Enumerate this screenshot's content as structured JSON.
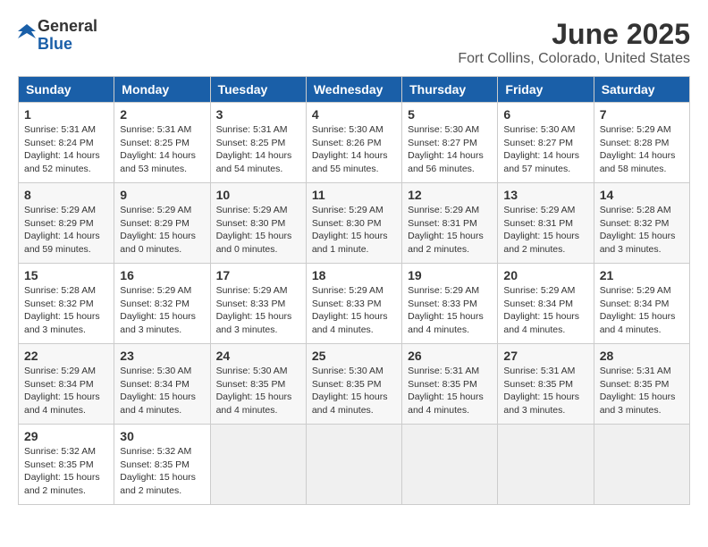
{
  "header": {
    "logo_general": "General",
    "logo_blue": "Blue",
    "month": "June 2025",
    "location": "Fort Collins, Colorado, United States"
  },
  "days_of_week": [
    "Sunday",
    "Monday",
    "Tuesday",
    "Wednesday",
    "Thursday",
    "Friday",
    "Saturday"
  ],
  "weeks": [
    [
      {
        "day": "1",
        "sunrise": "5:31 AM",
        "sunset": "8:24 PM",
        "daylight": "14 hours and 52 minutes."
      },
      {
        "day": "2",
        "sunrise": "5:31 AM",
        "sunset": "8:25 PM",
        "daylight": "14 hours and 53 minutes."
      },
      {
        "day": "3",
        "sunrise": "5:31 AM",
        "sunset": "8:25 PM",
        "daylight": "14 hours and 54 minutes."
      },
      {
        "day": "4",
        "sunrise": "5:30 AM",
        "sunset": "8:26 PM",
        "daylight": "14 hours and 55 minutes."
      },
      {
        "day": "5",
        "sunrise": "5:30 AM",
        "sunset": "8:27 PM",
        "daylight": "14 hours and 56 minutes."
      },
      {
        "day": "6",
        "sunrise": "5:30 AM",
        "sunset": "8:27 PM",
        "daylight": "14 hours and 57 minutes."
      },
      {
        "day": "7",
        "sunrise": "5:29 AM",
        "sunset": "8:28 PM",
        "daylight": "14 hours and 58 minutes."
      }
    ],
    [
      {
        "day": "8",
        "sunrise": "5:29 AM",
        "sunset": "8:29 PM",
        "daylight": "14 hours and 59 minutes."
      },
      {
        "day": "9",
        "sunrise": "5:29 AM",
        "sunset": "8:29 PM",
        "daylight": "15 hours and 0 minutes."
      },
      {
        "day": "10",
        "sunrise": "5:29 AM",
        "sunset": "8:30 PM",
        "daylight": "15 hours and 0 minutes."
      },
      {
        "day": "11",
        "sunrise": "5:29 AM",
        "sunset": "8:30 PM",
        "daylight": "15 hours and 1 minute."
      },
      {
        "day": "12",
        "sunrise": "5:29 AM",
        "sunset": "8:31 PM",
        "daylight": "15 hours and 2 minutes."
      },
      {
        "day": "13",
        "sunrise": "5:29 AM",
        "sunset": "8:31 PM",
        "daylight": "15 hours and 2 minutes."
      },
      {
        "day": "14",
        "sunrise": "5:28 AM",
        "sunset": "8:32 PM",
        "daylight": "15 hours and 3 minutes."
      }
    ],
    [
      {
        "day": "15",
        "sunrise": "5:28 AM",
        "sunset": "8:32 PM",
        "daylight": "15 hours and 3 minutes."
      },
      {
        "day": "16",
        "sunrise": "5:29 AM",
        "sunset": "8:32 PM",
        "daylight": "15 hours and 3 minutes."
      },
      {
        "day": "17",
        "sunrise": "5:29 AM",
        "sunset": "8:33 PM",
        "daylight": "15 hours and 3 minutes."
      },
      {
        "day": "18",
        "sunrise": "5:29 AM",
        "sunset": "8:33 PM",
        "daylight": "15 hours and 4 minutes."
      },
      {
        "day": "19",
        "sunrise": "5:29 AM",
        "sunset": "8:33 PM",
        "daylight": "15 hours and 4 minutes."
      },
      {
        "day": "20",
        "sunrise": "5:29 AM",
        "sunset": "8:34 PM",
        "daylight": "15 hours and 4 minutes."
      },
      {
        "day": "21",
        "sunrise": "5:29 AM",
        "sunset": "8:34 PM",
        "daylight": "15 hours and 4 minutes."
      }
    ],
    [
      {
        "day": "22",
        "sunrise": "5:29 AM",
        "sunset": "8:34 PM",
        "daylight": "15 hours and 4 minutes."
      },
      {
        "day": "23",
        "sunrise": "5:30 AM",
        "sunset": "8:34 PM",
        "daylight": "15 hours and 4 minutes."
      },
      {
        "day": "24",
        "sunrise": "5:30 AM",
        "sunset": "8:35 PM",
        "daylight": "15 hours and 4 minutes."
      },
      {
        "day": "25",
        "sunrise": "5:30 AM",
        "sunset": "8:35 PM",
        "daylight": "15 hours and 4 minutes."
      },
      {
        "day": "26",
        "sunrise": "5:31 AM",
        "sunset": "8:35 PM",
        "daylight": "15 hours and 4 minutes."
      },
      {
        "day": "27",
        "sunrise": "5:31 AM",
        "sunset": "8:35 PM",
        "daylight": "15 hours and 3 minutes."
      },
      {
        "day": "28",
        "sunrise": "5:31 AM",
        "sunset": "8:35 PM",
        "daylight": "15 hours and 3 minutes."
      }
    ],
    [
      {
        "day": "29",
        "sunrise": "5:32 AM",
        "sunset": "8:35 PM",
        "daylight": "15 hours and 2 minutes."
      },
      {
        "day": "30",
        "sunrise": "5:32 AM",
        "sunset": "8:35 PM",
        "daylight": "15 hours and 2 minutes."
      },
      null,
      null,
      null,
      null,
      null
    ]
  ],
  "labels": {
    "sunrise": "Sunrise:",
    "sunset": "Sunset:",
    "daylight": "Daylight:"
  }
}
